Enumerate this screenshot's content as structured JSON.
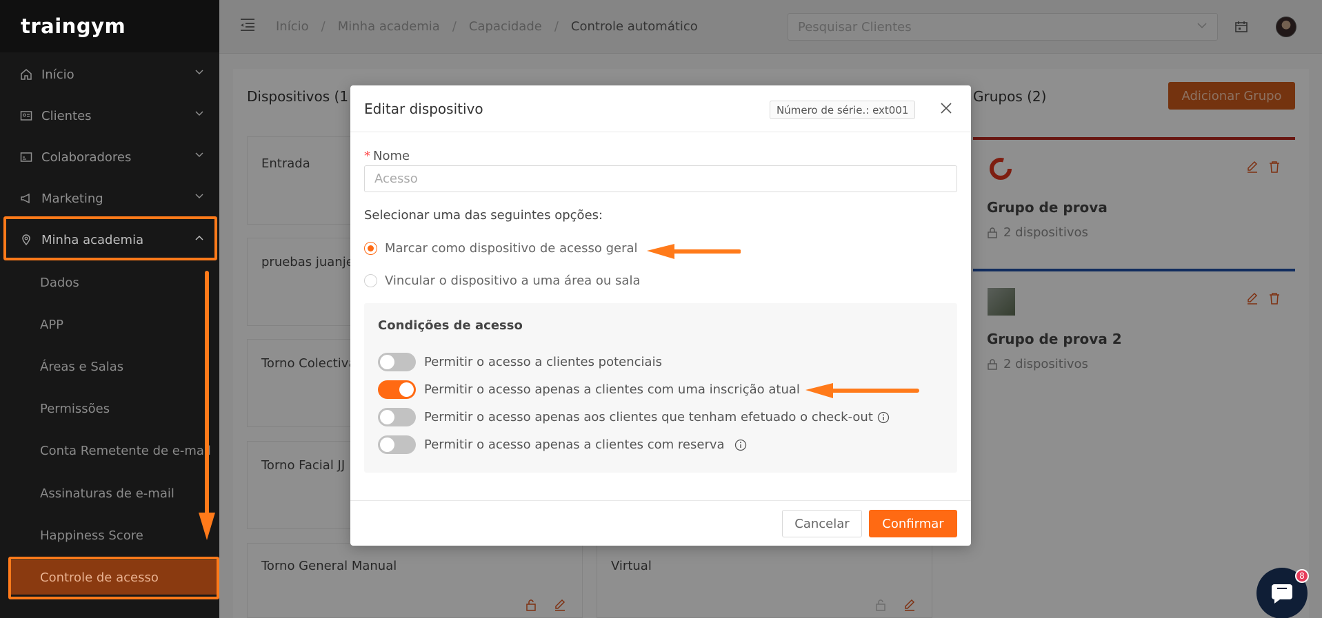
{
  "app": {
    "logo": "traingym"
  },
  "sidebar": {
    "items": [
      {
        "label": "Início",
        "icon": "home-icon"
      },
      {
        "label": "Clientes",
        "icon": "id-card-icon"
      },
      {
        "label": "Colaboradores",
        "icon": "badge-icon"
      },
      {
        "label": "Marketing",
        "icon": "megaphone-icon"
      },
      {
        "label": "Minha academia",
        "icon": "location-pin-icon"
      }
    ],
    "subitems": [
      "Dados",
      "APP",
      "Áreas e Salas",
      "Permissões",
      "Conta Remetente de e-mail",
      "Assinaturas de e-mail",
      "Happiness Score",
      "Controle de acesso"
    ]
  },
  "topbar": {
    "breadcrumb": [
      "Início",
      "Minha academia",
      "Capacidade",
      "Controle automático"
    ],
    "search_placeholder": "Pesquisar Clientes"
  },
  "devices_panel": {
    "title": "Dispositivos (1",
    "cards": [
      "Entrada",
      "pruebas juanje",
      "Torno Colectiva",
      "Torno Facial JJ",
      "Torno General Manual",
      "Virtual"
    ]
  },
  "groups_panel": {
    "title": "Grupos (2)",
    "add_button": "Adicionar Grupo",
    "groups": [
      {
        "name": "Grupo de prova",
        "devices": "2 dispositivos",
        "accent": "#b3261e"
      },
      {
        "name": "Grupo de prova 2",
        "devices": "2 dispositivos",
        "accent": "#1f4fa3"
      }
    ]
  },
  "modal": {
    "title": "Editar dispositivo",
    "serial": "Número de série.: ext001",
    "name_label": "Nome",
    "name_required": "*",
    "name_placeholder": "Acesso",
    "select_label": "Selecionar uma das seguintes opções:",
    "options": [
      {
        "label": "Marcar como dispositivo de acesso geral",
        "selected": true
      },
      {
        "label": "Vincular o dispositivo a uma área ou sala",
        "selected": false
      }
    ],
    "conditions_title": "Condições de acesso",
    "conditions": [
      {
        "label": "Permitir o acesso a clientes potenciais",
        "on": false
      },
      {
        "label": "Permitir o acesso apenas a clientes com uma inscrição atual",
        "on": true
      },
      {
        "label": "Permitir o acesso apenas aos clientes que tenham efetuado o check-out",
        "on": false
      },
      {
        "label": "Permitir o acesso apenas a clientes com reserva",
        "on": false
      }
    ],
    "cancel": "Cancelar",
    "confirm": "Confirmar"
  },
  "chat": {
    "badge": "8"
  },
  "colors": {
    "accent": "#ff6a13",
    "highlight": "#ff7a1a",
    "sidebar": "#171717"
  }
}
